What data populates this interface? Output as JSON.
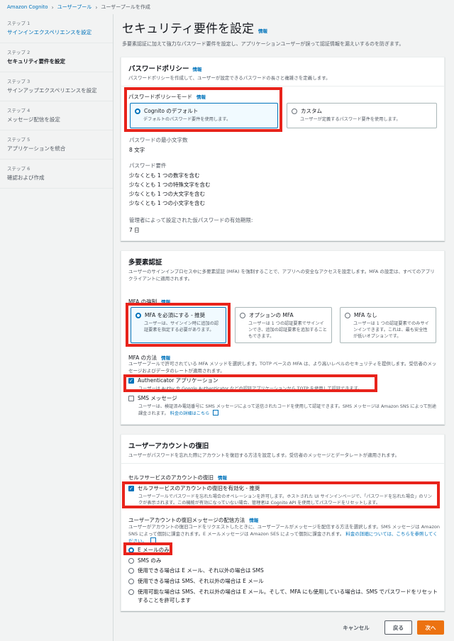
{
  "breadcrumb": {
    "items": [
      "Amazon Cognito",
      "ユーザープール",
      "ユーザープールを作成"
    ]
  },
  "steps": [
    {
      "no": "ステップ 1",
      "title": "サインインエクスペリエンスを設定"
    },
    {
      "no": "ステップ 2",
      "title": "セキュリティ要件を設定"
    },
    {
      "no": "ステップ 3",
      "title": "サインアップエクスペリエンスを設定"
    },
    {
      "no": "ステップ 4",
      "title": "メッセージ配信を設定"
    },
    {
      "no": "ステップ 5",
      "title": "アプリケーションを統合"
    },
    {
      "no": "ステップ 6",
      "title": "確認および作成"
    }
  ],
  "page": {
    "title": "セキュリティ要件を設定",
    "info": "情報",
    "desc": "多要素認証に加えて強力なパスワード要件を設定し、アプリケーションユーザーが誤って認証情報を漏えいするのを防ぎます。"
  },
  "password": {
    "title": "パスワードポリシー",
    "info": "情報",
    "desc": "パスワードポリシーを作成して、ユーザーが設定できるパスワードの長さと複雑さを定義します。",
    "mode_label": "パスワードポリシーモード",
    "mode_info": "情報",
    "opt_default_title": "Cognito のデフォルト",
    "opt_default_desc": "デフォルトのパスワード要件を使用します。",
    "opt_custom_title": "カスタム",
    "opt_custom_desc": "ユーザーが定義するパスワード要件を使用します。",
    "min_len_label": "パスワードの最小文字数",
    "min_len_value": "8 文字",
    "req_label": "パスワード要件",
    "req_items": [
      "少なくとも 1 つの数字を含む",
      "少なくとも 1 つの特殊文字を含む",
      "少なくとも 1 つの大文字を含む",
      "少なくとも 1 つの小文字を含む"
    ],
    "temp_label": "管理者によって設定された仮パスワードの有効期限:",
    "temp_value": "7 日"
  },
  "mfa": {
    "title": "多要素認証",
    "desc": "ユーザーのサインインプロセス中に多要素認証 (MFA) を強制することで、アプリへの安全なアクセスを設定します。MFA の設定は、すべてのアプリクライアントに適用されます。",
    "enforce_label": "MFA の強制",
    "enforce_info": "情報",
    "opt_required_title": "MFA を必須にする - 推奨",
    "opt_required_desc": "ユーザーは、サインイン時に追加の認証要素を指定する必要があります。",
    "opt_optional_title": "オプションの MFA",
    "opt_optional_desc": "ユーザーは 1 つの認証要素でサインインでき、追加の認証要素を追加することもできます。",
    "opt_none_title": "MFA なし",
    "opt_none_desc": "ユーザーは 1 つの認証要素でのみサインインできます。これは、最も安全性が低いオプションです。",
    "methods_label": "MFA の方法",
    "methods_info": "情報",
    "methods_desc": "ユーザープールで許可されている MFA メソッドを選択します。TOTP ベースの MFA は、より高いレベルのセキュリティを提供します。受信者のメッセージおよびデータのレートが適用されます。",
    "auth_title": "Authenticator アプリケーション",
    "auth_desc": "ユーザーは Authy や Google Authenticator などの認証アプリケーションから TOTP を使用して認証できます。",
    "sms_title": "SMS メッセージ",
    "sms_desc": "ユーザーは、検証済み電話番号に SMS メッセージによって送信されたコードを使用して認証できます。SMS メッセージは Amazon SNS によって別途課金されます。",
    "sms_link": "料金の詳細はこちら"
  },
  "recovery": {
    "title": "ユーザーアカウントの復旧",
    "desc": "ユーザーがパスワードを忘れた際にアカウントを復旧する方法を設定します。受信者のメッセージとデータレートが適用されます。",
    "self_label": "セルフサービスのアカウントの復旧",
    "self_info": "情報",
    "self_check_title": "セルフサービスのアカウントの復旧を有効化 - 推奨",
    "self_check_desc": "ユーザープールでパスワードを忘れた場合のオペレーションを許可します。ホストされた UI サインインページで、「パスワードを忘れた場合」のリンクが表示されます。この機能が有効になっていない場合、管理者は Cognito API を使用してパスワードをリセットします。",
    "delivery_label": "ユーザーアカウントの復旧メッセージの配信方法",
    "delivery_info": "情報",
    "delivery_desc": "ユーザーがアカウントの復旧コードをリクエストしたときに、ユーザープールがメッセージを配信する方法を選択します。SMS メッセージは Amazon SNS によって個別に課金されます。E メールメッセージは Amazon SES によって個別に課金されます。",
    "delivery_link": "料金の詳細については、こちらを参照してください。",
    "options": [
      "E メールのみ",
      "SMS のみ",
      "使用できる場合は E メール、それ以外の場合は SMS",
      "使用できる場合は SMS、それ以外の場合は E メール",
      "使用可能な場合は SMS、それ以外の場合は E メール。そして、MFA にも使用している場合は、SMS でパスワードをリセットすることを許可します"
    ]
  },
  "footer": {
    "cancel": "キャンセル",
    "back": "戻る",
    "next": "次へ"
  },
  "colors": {
    "accent": "#0073bb",
    "primary_button": "#ec7211",
    "highlight": "#e8231b"
  }
}
